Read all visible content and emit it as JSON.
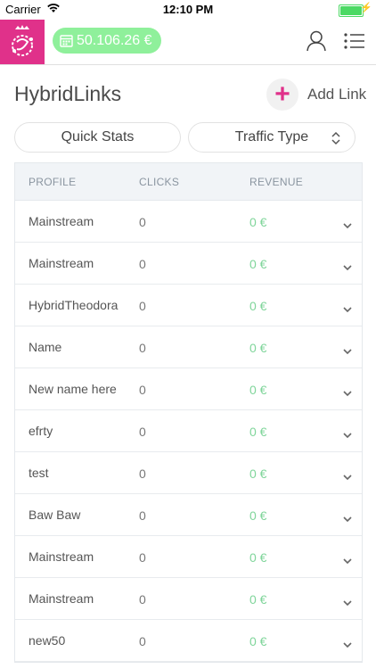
{
  "status": {
    "carrier": "Carrier",
    "time": "12:10 PM",
    "battery_level": 1.0
  },
  "header": {
    "balance": "50.106.26 €",
    "icons": [
      "logo-icon",
      "calendar-icon",
      "user-icon",
      "menu-icon"
    ]
  },
  "page": {
    "title": "HybridLinks",
    "add_link": "Add Link"
  },
  "filters": {
    "quick_stats": "Quick Stats",
    "traffic_type": "Traffic Type"
  },
  "table": {
    "columns": [
      "PROFILE",
      "CLICKS",
      "REVENUE"
    ],
    "rows": [
      {
        "profile": "Mainstream",
        "clicks": "0",
        "revenue": "0 €"
      },
      {
        "profile": "Mainstream",
        "clicks": "0",
        "revenue": "0 €"
      },
      {
        "profile": "HybridTheodora",
        "clicks": "0",
        "revenue": "0 €"
      },
      {
        "profile": "Name",
        "clicks": "0",
        "revenue": "0 €"
      },
      {
        "profile": "New name here",
        "clicks": "0",
        "revenue": "0 €"
      },
      {
        "profile": "efrty",
        "clicks": "0",
        "revenue": "0 €"
      },
      {
        "profile": "test",
        "clicks": "0",
        "revenue": "0 €"
      },
      {
        "profile": "Baw Baw",
        "clicks": "0",
        "revenue": "0 €"
      },
      {
        "profile": "Mainstream",
        "clicks": "0",
        "revenue": "0 €"
      },
      {
        "profile": "Mainstream",
        "clicks": "0",
        "revenue": "0 €"
      },
      {
        "profile": "new50",
        "clicks": "0",
        "revenue": "0 €"
      }
    ]
  },
  "colors": {
    "brand_pink": "#e0318a",
    "balance_green": "#8ff09b",
    "revenue_green": "#7fd59a"
  }
}
